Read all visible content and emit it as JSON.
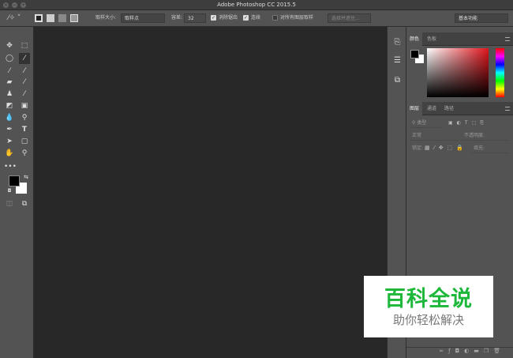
{
  "window": {
    "title": "Adobe Photoshop CC 2015.5",
    "controls": [
      "close",
      "minimize",
      "maximize"
    ]
  },
  "options_bar": {
    "tool_icon": "magic-wand-icon",
    "sample_size_label": "取样大小:",
    "sample_size_value": "取样点",
    "tolerance_label": "容差:",
    "tolerance_value": "32",
    "antialias_label": "消除锯齿",
    "antialias_checked": true,
    "contiguous_label": "连续",
    "contiguous_checked": true,
    "sample_all_layers_label": "对所有图层取样",
    "sample_all_layers_checked": false,
    "select_subject_label": "选择并遮住...",
    "workspace_value": "基本功能"
  },
  "tools": [
    "move",
    "marquee",
    "lasso",
    "magic-wand",
    "eyedropper",
    "color-sampler",
    "healing-brush",
    "brush",
    "clone-stamp",
    "history-brush",
    "eraser",
    "gradient",
    "blur",
    "dodge",
    "pen",
    "type",
    "path-selection",
    "rectangle",
    "hand",
    "zoom",
    "more",
    "quick-mask",
    "screen-mode"
  ],
  "colors": {
    "foreground": "#000000",
    "background": "#ffffff",
    "accent_watermark": "#1db83a"
  },
  "color_panel": {
    "tabs": [
      "颜色",
      "色板"
    ],
    "active": 0
  },
  "layers_panel": {
    "tabs": [
      "图层",
      "通道",
      "路径"
    ],
    "active": 0,
    "filter_label": "类型",
    "blend_mode": "正常",
    "opacity_label": "不透明度:",
    "lock_label": "锁定:",
    "fill_label": "填充:"
  },
  "watermark": {
    "title": "百科全说",
    "subtitle": "助你轻松解决"
  }
}
